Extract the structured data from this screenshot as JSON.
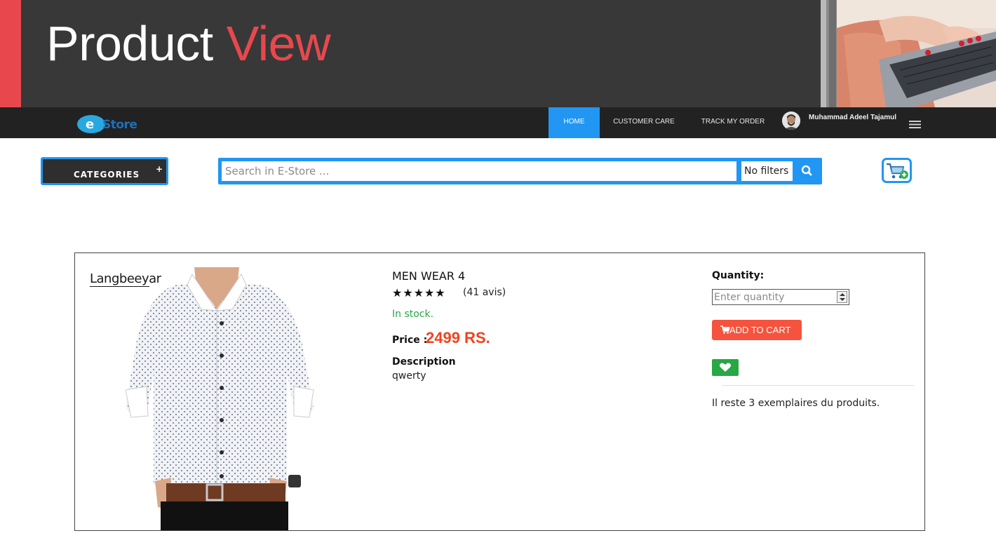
{
  "slide": {
    "title_word1": "Product",
    "title_word2": "View",
    "accent_color": "#e8484d"
  },
  "navbar": {
    "logo_text": "eStore",
    "items": [
      {
        "label": "HOME",
        "active": true
      },
      {
        "label": "CUSTOMER CARE",
        "active": false
      },
      {
        "label": "TRACK MY ORDER",
        "active": false
      }
    ],
    "user_name": "Muhammad Adeel Tajamul",
    "menu_icon": "hamburger-icon",
    "accent_color": "#2196f3"
  },
  "toolbar": {
    "categories_label": "CATEGORIES",
    "categories_icon": "plus",
    "search_placeholder": "Search in E-Store ...",
    "filter_selected": "No filters",
    "search_icon": "search-icon",
    "cart_icon": "cart-add-icon"
  },
  "product": {
    "brand": "Langbeeyar",
    "name": "MEN WEAR 4",
    "rating": 5,
    "rating_max": 5,
    "reviews": "(41 avis)",
    "stock_status": "In stock.",
    "price_label": "Price :",
    "price": "2499 RS.",
    "description_label": "Description",
    "description": "qwerty",
    "quantity_label": "Quantity:",
    "quantity_placeholder": "Enter quantity",
    "add_to_cart_label": "ADD TO CART",
    "wishlist_icon": "heart-icon",
    "remaining_text": "Il reste 3 exemplaires du produits.",
    "price_color": "#f2421c",
    "stock_color": "#28a745",
    "button_color": "#f5533d"
  }
}
